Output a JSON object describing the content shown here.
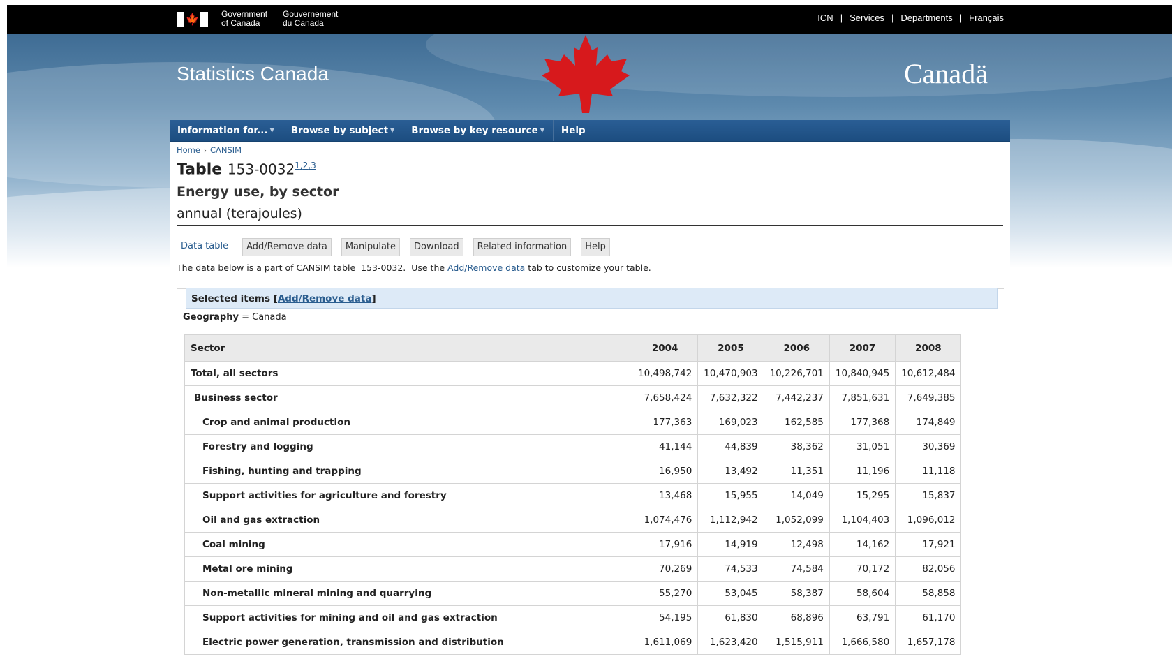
{
  "header": {
    "gov_en_line1": "Government",
    "gov_en_line2": "of Canada",
    "gov_fr_line1": "Gouvernement",
    "gov_fr_line2": "du Canada",
    "flag_glyph": "🍁",
    "links": [
      "ICN",
      "Services",
      "Departments",
      "Français"
    ],
    "site_title": "Statistics Canada",
    "wordmark": "Canadä"
  },
  "nav": {
    "items": [
      "Information for...",
      "Browse by subject",
      "Browse by key resource",
      "Help"
    ]
  },
  "breadcrumb": {
    "home": "Home",
    "current": "CANSIM",
    "sep": "›"
  },
  "table_header": {
    "label": "Table",
    "number": "153-0032",
    "footnotes": [
      "1",
      "2",
      "3"
    ],
    "title": "Energy use, by sector",
    "unit": "annual (terajoules)"
  },
  "tabs": [
    "Data table",
    "Add/Remove data",
    "Manipulate",
    "Download",
    "Related information",
    "Help"
  ],
  "intro": {
    "before": "The data below is a part of CANSIM table  153-0032.  Use the ",
    "link": "Add/Remove data",
    "after": " tab to customize your table."
  },
  "selected": {
    "label": "Selected items",
    "bracket_open": "[",
    "link": "Add/Remove data",
    "bracket_close": "]",
    "geo_key": "Geography",
    "geo_eq": " = ",
    "geo_val": "Canada"
  },
  "data_table": {
    "columns": [
      "Sector",
      "2004",
      "2005",
      "2006",
      "2007",
      "2008"
    ],
    "rows": [
      {
        "label": "Total, all sectors",
        "level": 0,
        "values": [
          "10,498,742",
          "10,470,903",
          "10,226,701",
          "10,840,945",
          "10,612,484"
        ]
      },
      {
        "label": "Business sector",
        "level": 1,
        "values": [
          "7,658,424",
          "7,632,322",
          "7,442,237",
          "7,851,631",
          "7,649,385"
        ]
      },
      {
        "label": "Crop and animal production",
        "level": 2,
        "values": [
          "177,363",
          "169,023",
          "162,585",
          "177,368",
          "174,849"
        ]
      },
      {
        "label": "Forestry and logging",
        "level": 2,
        "values": [
          "41,144",
          "44,839",
          "38,362",
          "31,051",
          "30,369"
        ]
      },
      {
        "label": "Fishing, hunting and trapping",
        "level": 2,
        "values": [
          "16,950",
          "13,492",
          "11,351",
          "11,196",
          "11,118"
        ]
      },
      {
        "label": "Support activities for agriculture and forestry",
        "level": 2,
        "values": [
          "13,468",
          "15,955",
          "14,049",
          "15,295",
          "15,837"
        ]
      },
      {
        "label": "Oil and gas extraction",
        "level": 2,
        "values": [
          "1,074,476",
          "1,112,942",
          "1,052,099",
          "1,104,403",
          "1,096,012"
        ]
      },
      {
        "label": "Coal mining",
        "level": 2,
        "values": [
          "17,916",
          "14,919",
          "12,498",
          "14,162",
          "17,921"
        ]
      },
      {
        "label": "Metal ore mining",
        "level": 2,
        "values": [
          "70,269",
          "74,533",
          "74,584",
          "70,172",
          "82,056"
        ]
      },
      {
        "label": "Non-metallic mineral mining and quarrying",
        "level": 2,
        "values": [
          "55,270",
          "53,045",
          "58,387",
          "58,604",
          "58,858"
        ]
      },
      {
        "label": "Support activities for mining and oil and gas extraction",
        "level": 2,
        "values": [
          "54,195",
          "61,830",
          "68,896",
          "63,791",
          "61,170"
        ]
      },
      {
        "label": "Electric power generation, transmission and distribution",
        "level": 2,
        "values": [
          "1,611,069",
          "1,623,420",
          "1,515,911",
          "1,666,580",
          "1,657,178"
        ]
      }
    ]
  }
}
